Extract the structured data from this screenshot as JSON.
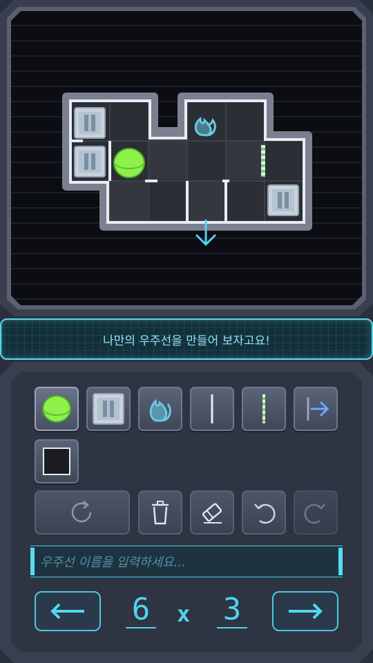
{
  "message": "나만의 우주선을 만들어 보자고요!",
  "name_input": {
    "placeholder": "우주선 이름을 입력하세요..."
  },
  "size": {
    "width": "6",
    "separator": "x",
    "height": "3"
  },
  "palette": [
    {
      "name": "green-ball-icon"
    },
    {
      "name": "crate-icon"
    },
    {
      "name": "fire-icon"
    },
    {
      "name": "wall-icon"
    },
    {
      "name": "striped-wall-icon"
    },
    {
      "name": "exit-arrow-icon"
    },
    {
      "name": "floor-tile-icon"
    }
  ],
  "colors": {
    "accent": "#4fd4ee",
    "ball": "#8ef04a",
    "fire": "#6bc9e6"
  }
}
